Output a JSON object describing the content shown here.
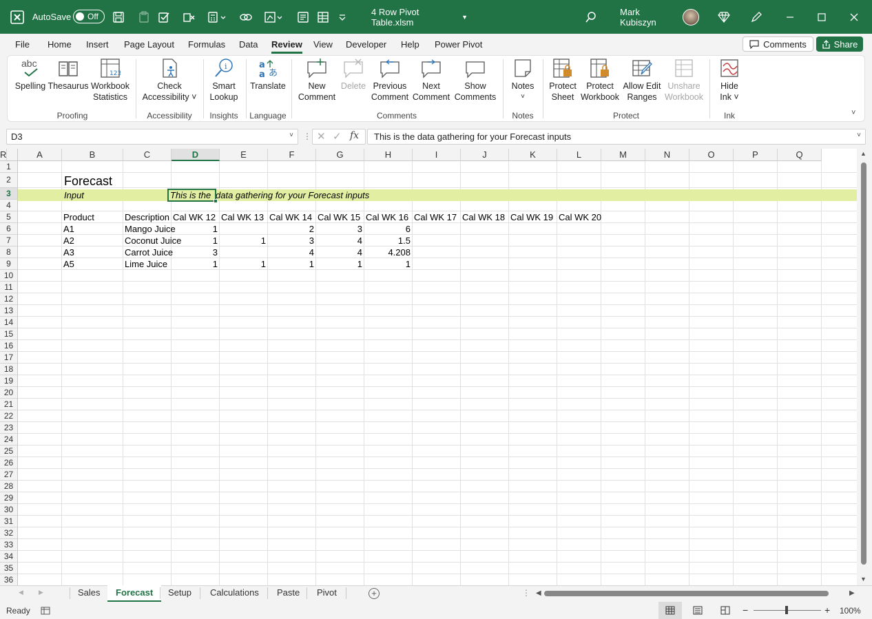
{
  "titlebar": {
    "autosave_label": "AutoSave",
    "autosave_state": "Off",
    "filename": "4 Row Pivot Table.xlsm",
    "user": "Mark Kubiszyn",
    "window_buttons": [
      "minimize",
      "restore",
      "close"
    ]
  },
  "menu": {
    "tabs": [
      "File",
      "Home",
      "Insert",
      "Page Layout",
      "Formulas",
      "Data",
      "Review",
      "View",
      "Developer",
      "Help",
      "Power Pivot"
    ],
    "active_tab": "Review",
    "comments_label": "Comments",
    "share_label": "Share"
  },
  "ribbon": {
    "spelling": "Spelling",
    "thesaurus": "Thesaurus",
    "workbook_statistics": [
      "Workbook",
      "Statistics"
    ],
    "proofing": "Proofing",
    "check_accessibility": [
      "Check",
      "Accessibility"
    ],
    "accessibility": "Accessibility",
    "smart_lookup": [
      "Smart",
      "Lookup"
    ],
    "insights": "Insights",
    "translate": "Translate",
    "language": "Language",
    "new_comment": [
      "New",
      "Comment"
    ],
    "delete": "Delete",
    "previous_comment": [
      "Previous",
      "Comment"
    ],
    "next_comment": [
      "Next",
      "Comment"
    ],
    "show_comments": [
      "Show",
      "Comments"
    ],
    "comments": "Comments",
    "notes_btn": "Notes",
    "notes": "Notes",
    "protect_sheet": [
      "Protect",
      "Sheet"
    ],
    "protect_workbook": [
      "Protect",
      "Workbook"
    ],
    "allow_edit_ranges": [
      "Allow Edit",
      "Ranges"
    ],
    "unshare_workbook": [
      "Unshare",
      "Workbook"
    ],
    "protect": "Protect",
    "hide_ink": [
      "Hide",
      "Ink"
    ],
    "ink": "Ink",
    "abc": "abc",
    "translate_glyph": "あ"
  },
  "formula_bar": {
    "name_box": "D3",
    "fx": "fx",
    "content": "This is the data gathering for your Forecast inputs"
  },
  "sheet": {
    "columns": [
      "A",
      "B",
      "C",
      "D",
      "E",
      "F",
      "G",
      "H",
      "I",
      "J",
      "K",
      "L",
      "M",
      "N",
      "O",
      "P",
      "Q",
      "R"
    ],
    "selected_column": "D",
    "selected_row": "3",
    "rows": [
      "1",
      "2",
      "3",
      "4",
      "5",
      "6",
      "7",
      "8",
      "9",
      "10",
      "11",
      "12",
      "13",
      "14",
      "15",
      "16",
      "17",
      "18",
      "19",
      "20",
      "21",
      "22",
      "23",
      "24",
      "25",
      "26",
      "27",
      "28",
      "29",
      "30",
      "31",
      "32",
      "33",
      "34",
      "35",
      "36"
    ],
    "title": "Forecast",
    "input_label": "Input",
    "input_text_part1": "This is the ",
    "input_text_part2": "data gathering for your Forecast inputs",
    "headers": [
      "Product",
      "Description",
      "Cal WK 12",
      "Cal WK 13",
      "Cal WK 14",
      "Cal WK 15",
      "Cal WK 16",
      "Cal WK 17",
      "Cal WK 18",
      "Cal WK 19",
      "Cal WK 20"
    ],
    "data_rows": [
      {
        "product": "A1",
        "description": "Mango Juice",
        "wk12": "1",
        "wk13": "",
        "wk14": "2",
        "wk15": "3",
        "wk16": "6"
      },
      {
        "product": "A2",
        "description": "Coconut Juice",
        "wk12": "1",
        "wk13": "1",
        "wk14": "3",
        "wk15": "4",
        "wk16": "1.5"
      },
      {
        "product": "A3",
        "description": "Carrot Juice",
        "wk12": "3",
        "wk13": "",
        "wk14": "4",
        "wk15": "4",
        "wk16": "4.208"
      },
      {
        "product": "A5",
        "description": "Lime Juice",
        "wk12": "1",
        "wk13": "1",
        "wk14": "1",
        "wk15": "1",
        "wk16": "1"
      }
    ],
    "highlight_color": "#e2efa2"
  },
  "sheet_tabs": {
    "tabs": [
      "Sales",
      "Forecast",
      "Setup",
      "Calculations",
      "Paste",
      "Pivot"
    ],
    "active": "Forecast"
  },
  "status": {
    "ready": "Ready",
    "zoom": "100%"
  },
  "colors": {
    "excel_green": "#217346"
  }
}
